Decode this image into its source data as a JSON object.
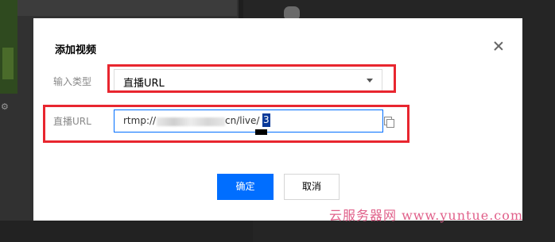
{
  "dialog": {
    "title": "添加视频",
    "input_type_label": "输入类型",
    "input_type_value": "直播URL",
    "url_label": "直播URL",
    "url_prefix": "rtmp://",
    "url_suffix": "cn/live/",
    "url_selected": "3",
    "ok_label": "确定",
    "cancel_label": "取消"
  },
  "watermark": "云服务器网 www.yuntue.com",
  "colors": {
    "primary": "#006eff",
    "annotation": "#e8262f",
    "watermark": "#e0608a"
  }
}
